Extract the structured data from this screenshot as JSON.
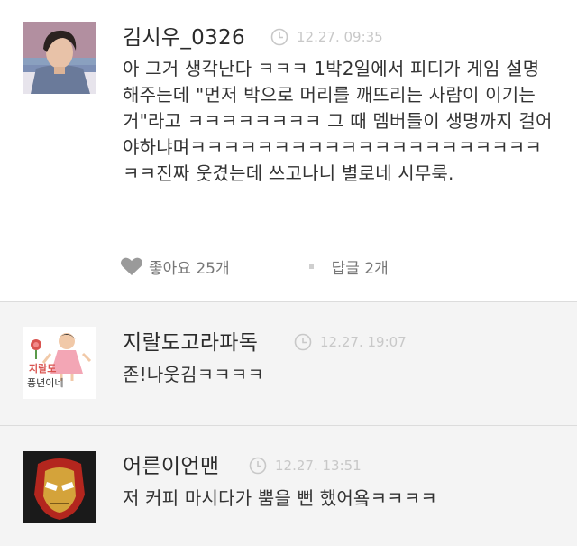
{
  "comments": [
    {
      "author": "김시우_0326",
      "time": "12.27. 09:35",
      "text": "아 그거 생각난다 ㅋㅋㅋ 1박2일에서 피디가 게임 설명해주는데 \"먼저 박으로 머리를 깨뜨리는 사람이 이기는거\"라고 ㅋㅋㅋㅋㅋㅋㅋㅋ 그 때 멤버들이 생명까지 걸어야하냐며ㅋㅋㅋㅋㅋㅋㅋㅋㅋㅋㅋㅋㅋㅋㅋㅋㅋㅋㅋㅋㅋㅋㅋ진짜 웃겼는데 쓰고나니 별로네 시무룩.",
      "like_label": "좋아요 25개",
      "reply_label": "답글 2개"
    },
    {
      "author": "지랄도고라파독",
      "time": "12.27. 19:07",
      "text": "존!나웃김ㅋㅋㅋㅋ",
      "avatar_text_1": "지랄도",
      "avatar_text_2": "풍년이네"
    },
    {
      "author": "어른이언맨",
      "time": "12.27. 13:51",
      "text": "저 커피 마시다가 뿜을 뻔 했어욬ㅋㅋㅋㅋ"
    }
  ],
  "colors": {
    "accent_text": "#333333",
    "timestamp": "#c8c8c8",
    "background_alt": "#f4f4f4"
  }
}
